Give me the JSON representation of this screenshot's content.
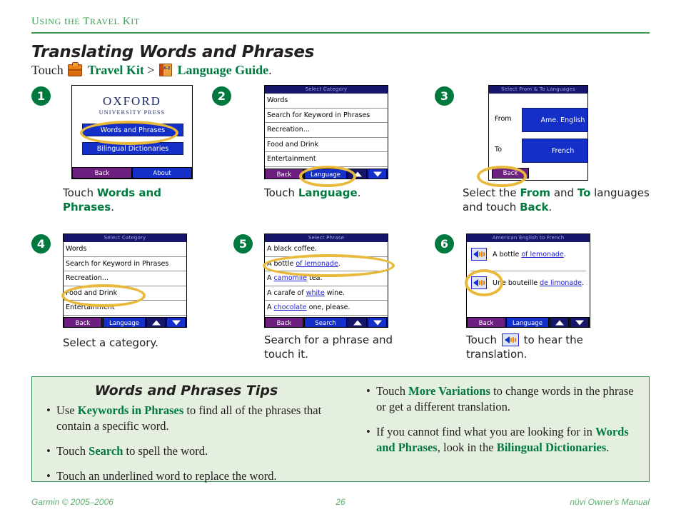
{
  "running_head": "Using the Travel Kit",
  "title": "Translating Words and Phrases",
  "subtitle": {
    "lead": "Touch",
    "kit_icon": "travel-kit-icon",
    "kit_label": "Travel Kit",
    "separator": ">",
    "guide_icon": "language-guide-book-icon",
    "guide_label": "Language Guide",
    "period": "."
  },
  "colors": {
    "green_accent": "#00793f",
    "head_green": "#3f9b52",
    "highlight_yellow": "#e8b93a",
    "device_navy": "#16166b",
    "device_blue": "#1430c8",
    "device_purple": "#6d2080",
    "tips_bg": "#e4efe0",
    "tips_border": "#2e8b4f",
    "link_blue": "#2020cf",
    "footer_green": "#5fae6e"
  },
  "steps": [
    {
      "number": "1",
      "screen": {
        "kind": "oxford",
        "logo": "OXFORD",
        "logo_sub": "UNIVERSITY PRESS",
        "buttons": [
          "Words and Phrases",
          "Bilingual Dictionaries"
        ],
        "bottom": [
          "Back",
          "About"
        ]
      },
      "caption": {
        "pre": "Touch ",
        "bold": "Words and Phrases",
        "post": "."
      }
    },
    {
      "number": "2",
      "screen": {
        "kind": "list",
        "title": "Select Category",
        "rows": [
          "Words",
          "Search for Keyword in Phrases",
          "Recreation...",
          "Food and Drink",
          "Entertainment"
        ],
        "bottom": [
          "Back",
          "Language",
          "up-arrow",
          "down-arrow"
        ]
      },
      "caption": {
        "pre": "Touch ",
        "bold": "Language",
        "post": "."
      }
    },
    {
      "number": "3",
      "screen": {
        "kind": "fromto",
        "title": "Select From & To Languages",
        "from_label": "From",
        "from_value": "Ame. English",
        "to_label": "To",
        "to_value": "French",
        "back": "Back"
      },
      "caption": {
        "pre": "Select the ",
        "bold": "From",
        "mid": " and ",
        "bold2": "To",
        "post": " languages and touch ",
        "bold3": "Back",
        "end": "."
      }
    },
    {
      "number": "4",
      "screen": {
        "kind": "list",
        "title": "Select Category",
        "rows": [
          "Words",
          "Search for Keyword in Phrases",
          "Recreation...",
          "Food and Drink",
          "Entertainment"
        ],
        "bottom": [
          "Back",
          "Language",
          "up-arrow",
          "down-arrow"
        ]
      },
      "caption": {
        "pre": "Select a category.",
        "bold": "",
        "post": ""
      }
    },
    {
      "number": "5",
      "screen": {
        "kind": "phrases",
        "title": "Select Phrase",
        "rows": [
          {
            "plain1": "A black coffee.",
            "link": "",
            "plain2": ""
          },
          {
            "plain1": "A bottle ",
            "link": "of lemonade",
            "plain2": "."
          },
          {
            "plain1": "A ",
            "link": "camomile",
            "plain2": " tea."
          },
          {
            "plain1": "A carafe of ",
            "link": "white",
            "plain2": " wine."
          },
          {
            "plain1": "A ",
            "link": "chocolate",
            "plain2": " one, please."
          }
        ],
        "bottom": [
          "Back",
          "Search",
          "up-arrow",
          "down-arrow"
        ]
      },
      "caption": {
        "pre": "Search for a phrase and touch it.",
        "bold": "",
        "post": ""
      }
    },
    {
      "number": "6",
      "screen": {
        "kind": "translation",
        "title": "American English to French",
        "rows": [
          {
            "icon": "speaker-icon",
            "plain1": "A bottle ",
            "link": "of lemonade",
            "plain2": "."
          },
          {
            "icon": "speaker-icon",
            "plain1": "Une bouteille ",
            "link": "de limonade",
            "plain2": "."
          }
        ],
        "bottom": [
          "Back",
          "Language",
          "up-arrow",
          "down-arrow"
        ]
      },
      "caption": {
        "pre": "Touch ",
        "icon": "speaker-icon",
        "post": " to hear the translation."
      }
    }
  ],
  "tips": {
    "title": "Words and Phrases Tips",
    "left": [
      {
        "pre": "Use ",
        "bold": "Keywords in Phrases",
        "post": " to find all of the phrases that contain a specific word."
      },
      {
        "pre": "Touch ",
        "bold": "Search",
        "post": " to spell the word."
      },
      {
        "pre": "Touch an underlined word to replace the word.",
        "bold": "",
        "post": ""
      }
    ],
    "right": [
      {
        "pre": "Touch ",
        "bold": "More Variations",
        "post": " to change words in the phrase or get a different translation."
      },
      {
        "pre": "If you cannot find what you are looking for in ",
        "bold": "Words and Phrases",
        "post": ", look in the ",
        "bold2": "Bilingual Dictionaries",
        "end": "."
      }
    ]
  },
  "footer": {
    "left": "Garmin © 2005–2006",
    "center": "26",
    "right": "nüvi Owner's Manual"
  }
}
